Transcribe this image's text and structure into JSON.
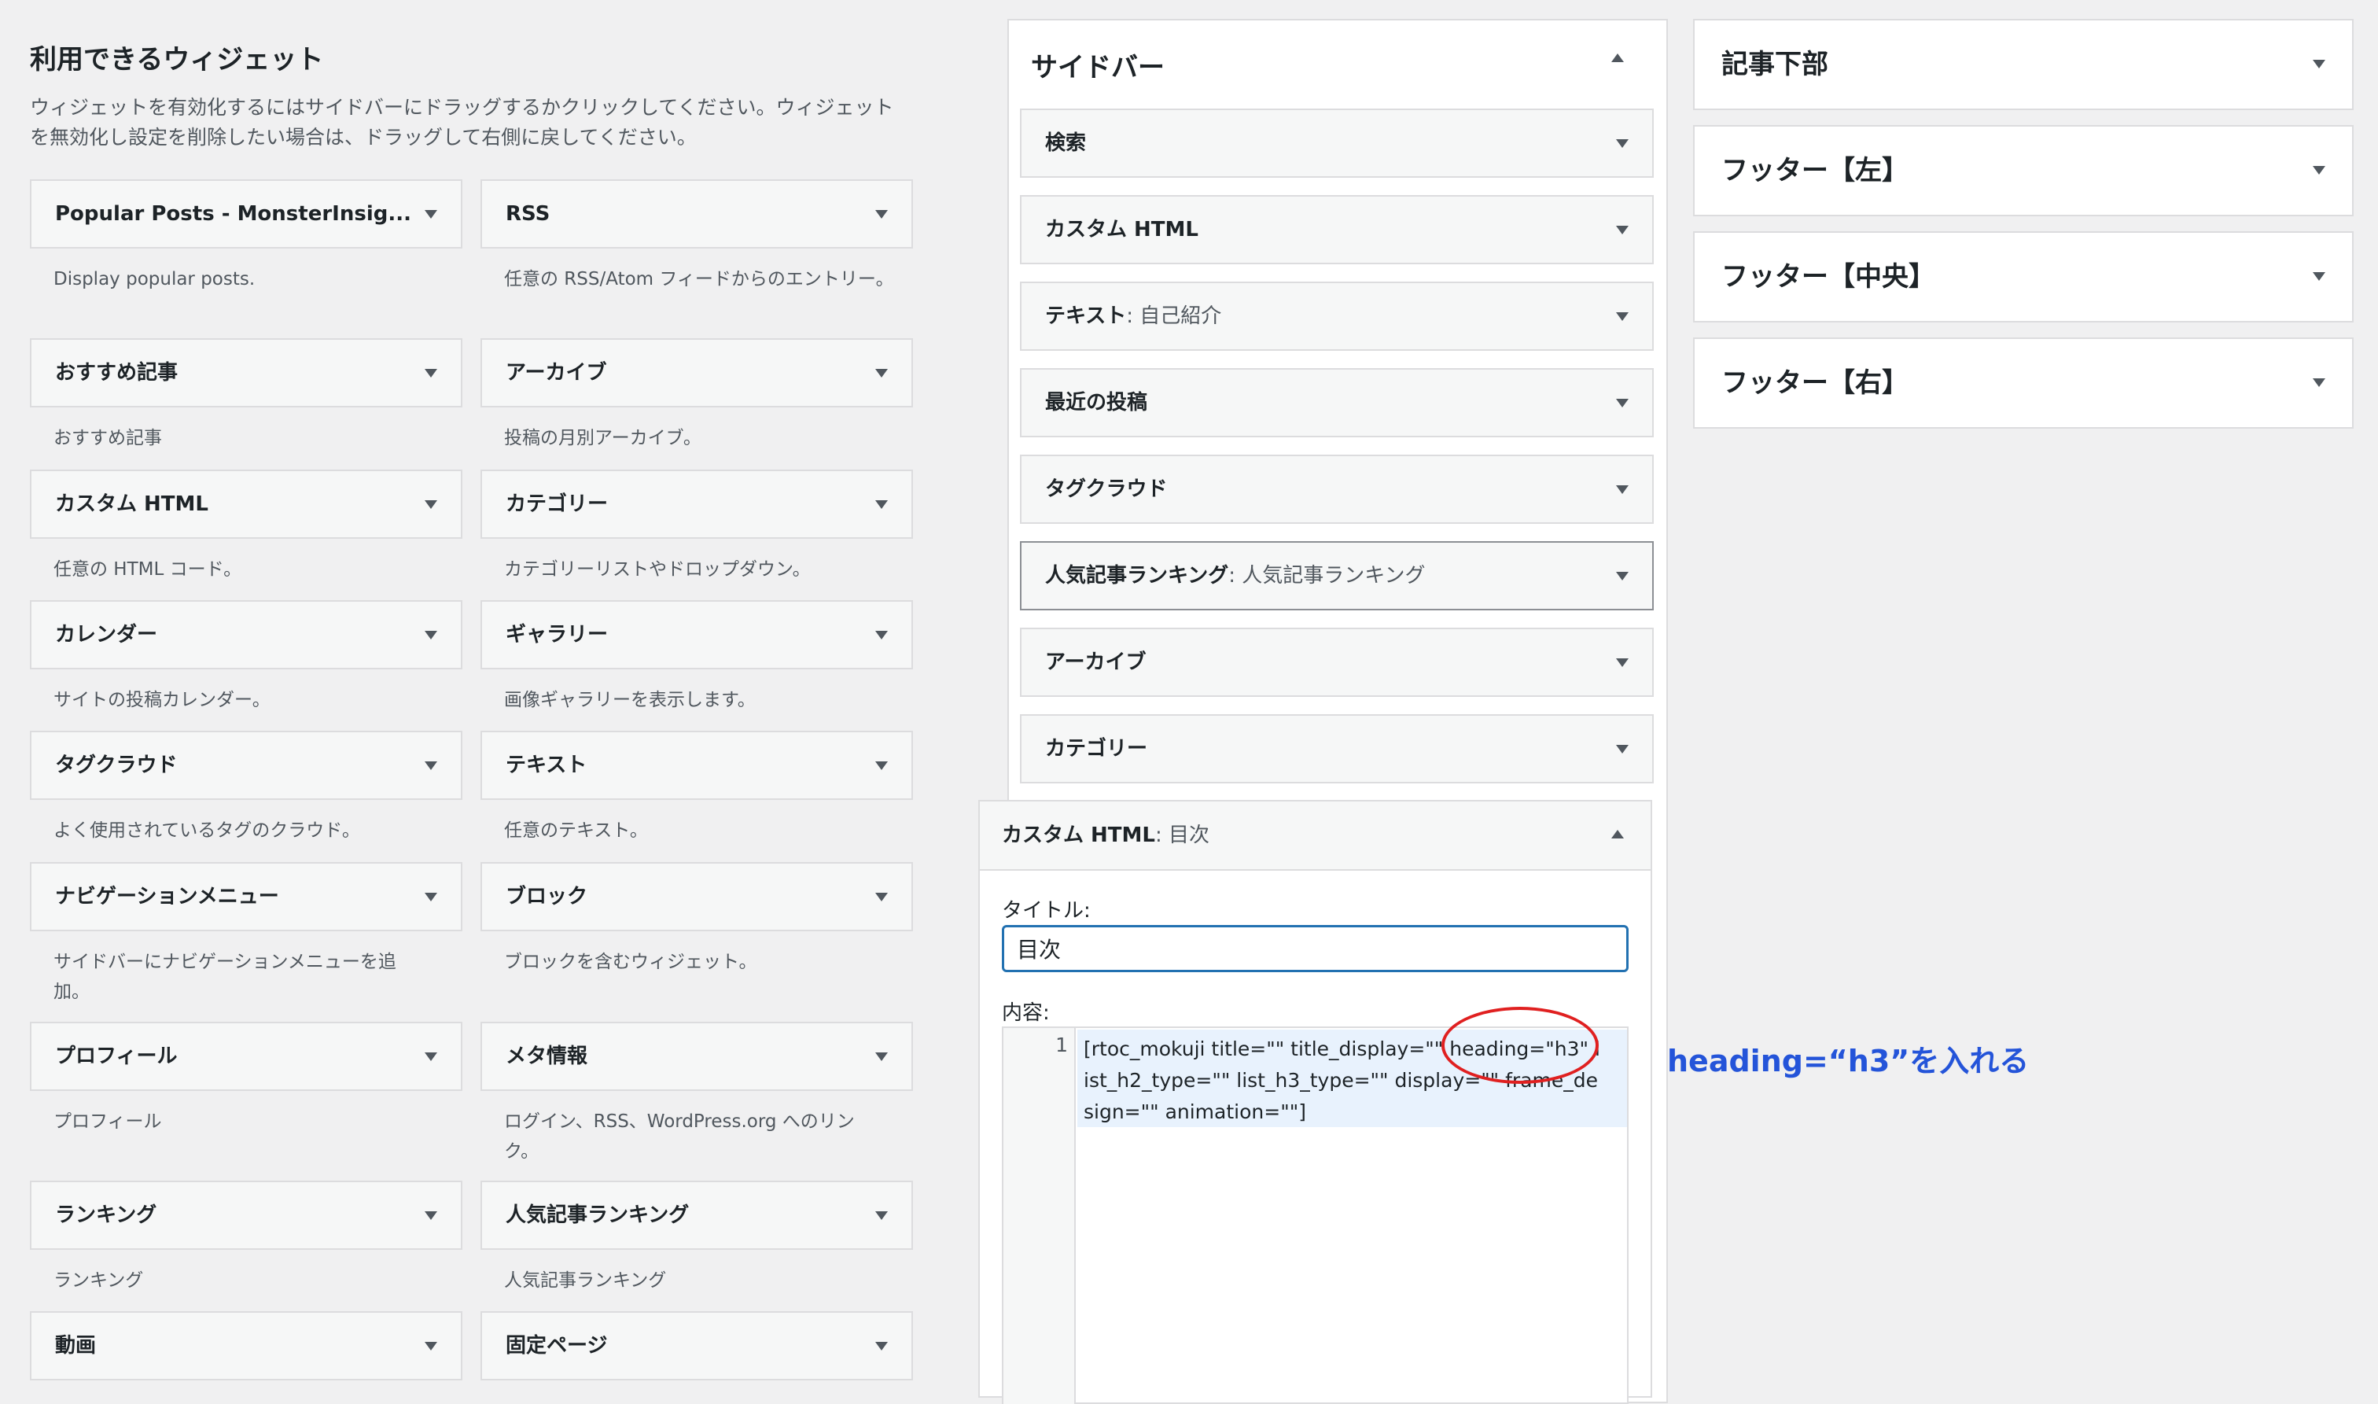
{
  "available": {
    "title": "利用できるウィジェット",
    "description": "ウィジェットを有効化するにはサイドバーにドラッグするかクリックしてください。ウィジェットを無効化し設定を削除したい場合は、ドラッグして右側に戻してください。",
    "widgets": [
      {
        "label": "Popular Posts - MonsterInsig...",
        "desc": "Display popular posts."
      },
      {
        "label": "RSS",
        "desc": "任意の RSS/Atom フィードからのエントリー。"
      },
      {
        "label": "おすすめ記事",
        "desc": "おすすめ記事"
      },
      {
        "label": "アーカイブ",
        "desc": "投稿の月別アーカイブ。"
      },
      {
        "label": "カスタム HTML",
        "desc": "任意の HTML コード。"
      },
      {
        "label": "カテゴリー",
        "desc": "カテゴリーリストやドロップダウン。"
      },
      {
        "label": "カレンダー",
        "desc": "サイトの投稿カレンダー。"
      },
      {
        "label": "ギャラリー",
        "desc": "画像ギャラリーを表示します。"
      },
      {
        "label": "タグクラウド",
        "desc": "よく使用されているタグのクラウド。"
      },
      {
        "label": "テキスト",
        "desc": "任意のテキスト。"
      },
      {
        "label": "ナビゲーションメニュー",
        "desc": "サイドバーにナビゲーションメニューを追加。"
      },
      {
        "label": "ブロック",
        "desc": "ブロックを含むウィジェット。"
      },
      {
        "label": "プロフィール",
        "desc": "プロフィール"
      },
      {
        "label": "メタ情報",
        "desc": "ログイン、RSS、WordPress.org へのリンク。"
      },
      {
        "label": "ランキング",
        "desc": "ランキング"
      },
      {
        "label": "人気記事ランキング",
        "desc": "人気記事ランキング"
      },
      {
        "label": "動画",
        "desc": ""
      },
      {
        "label": "固定ページ",
        "desc": ""
      }
    ]
  },
  "sidebar": {
    "title": "サイドバー",
    "items": [
      {
        "label": "検索",
        "sub": ""
      },
      {
        "label": "カスタム HTML",
        "sub": ""
      },
      {
        "label": "テキスト",
        "sub": ": 自己紹介"
      },
      {
        "label": "最近の投稿",
        "sub": ""
      },
      {
        "label": "タグクラウド",
        "sub": ""
      },
      {
        "label": "人気記事ランキング",
        "sub": ": 人気記事ランキング"
      },
      {
        "label": "アーカイブ",
        "sub": ""
      },
      {
        "label": "カテゴリー",
        "sub": ""
      }
    ],
    "expanded": {
      "title": "カスタム HTML",
      "title_sub": ": 目次",
      "title_field_label": "タイトル:",
      "title_field_value": "目次",
      "content_label": "内容:",
      "line_number": "1",
      "code": "[rtoc_mokuji title=\"\" title_display=\"\" heading=\"h3\" list_h2_type=\"\" list_h3_type=\"\" display=\"\" frame_design=\"\" animation=\"\"]"
    }
  },
  "annotation": "heading=“h3”を入れる",
  "right_areas": [
    "記事下部",
    "フッター【左】",
    "フッター【中央】",
    "フッター【右】"
  ],
  "colors": {
    "background": "#f0f0f1",
    "focus_border": "#2271b1",
    "circle": "#e02020",
    "annotation": "#2454d9"
  }
}
